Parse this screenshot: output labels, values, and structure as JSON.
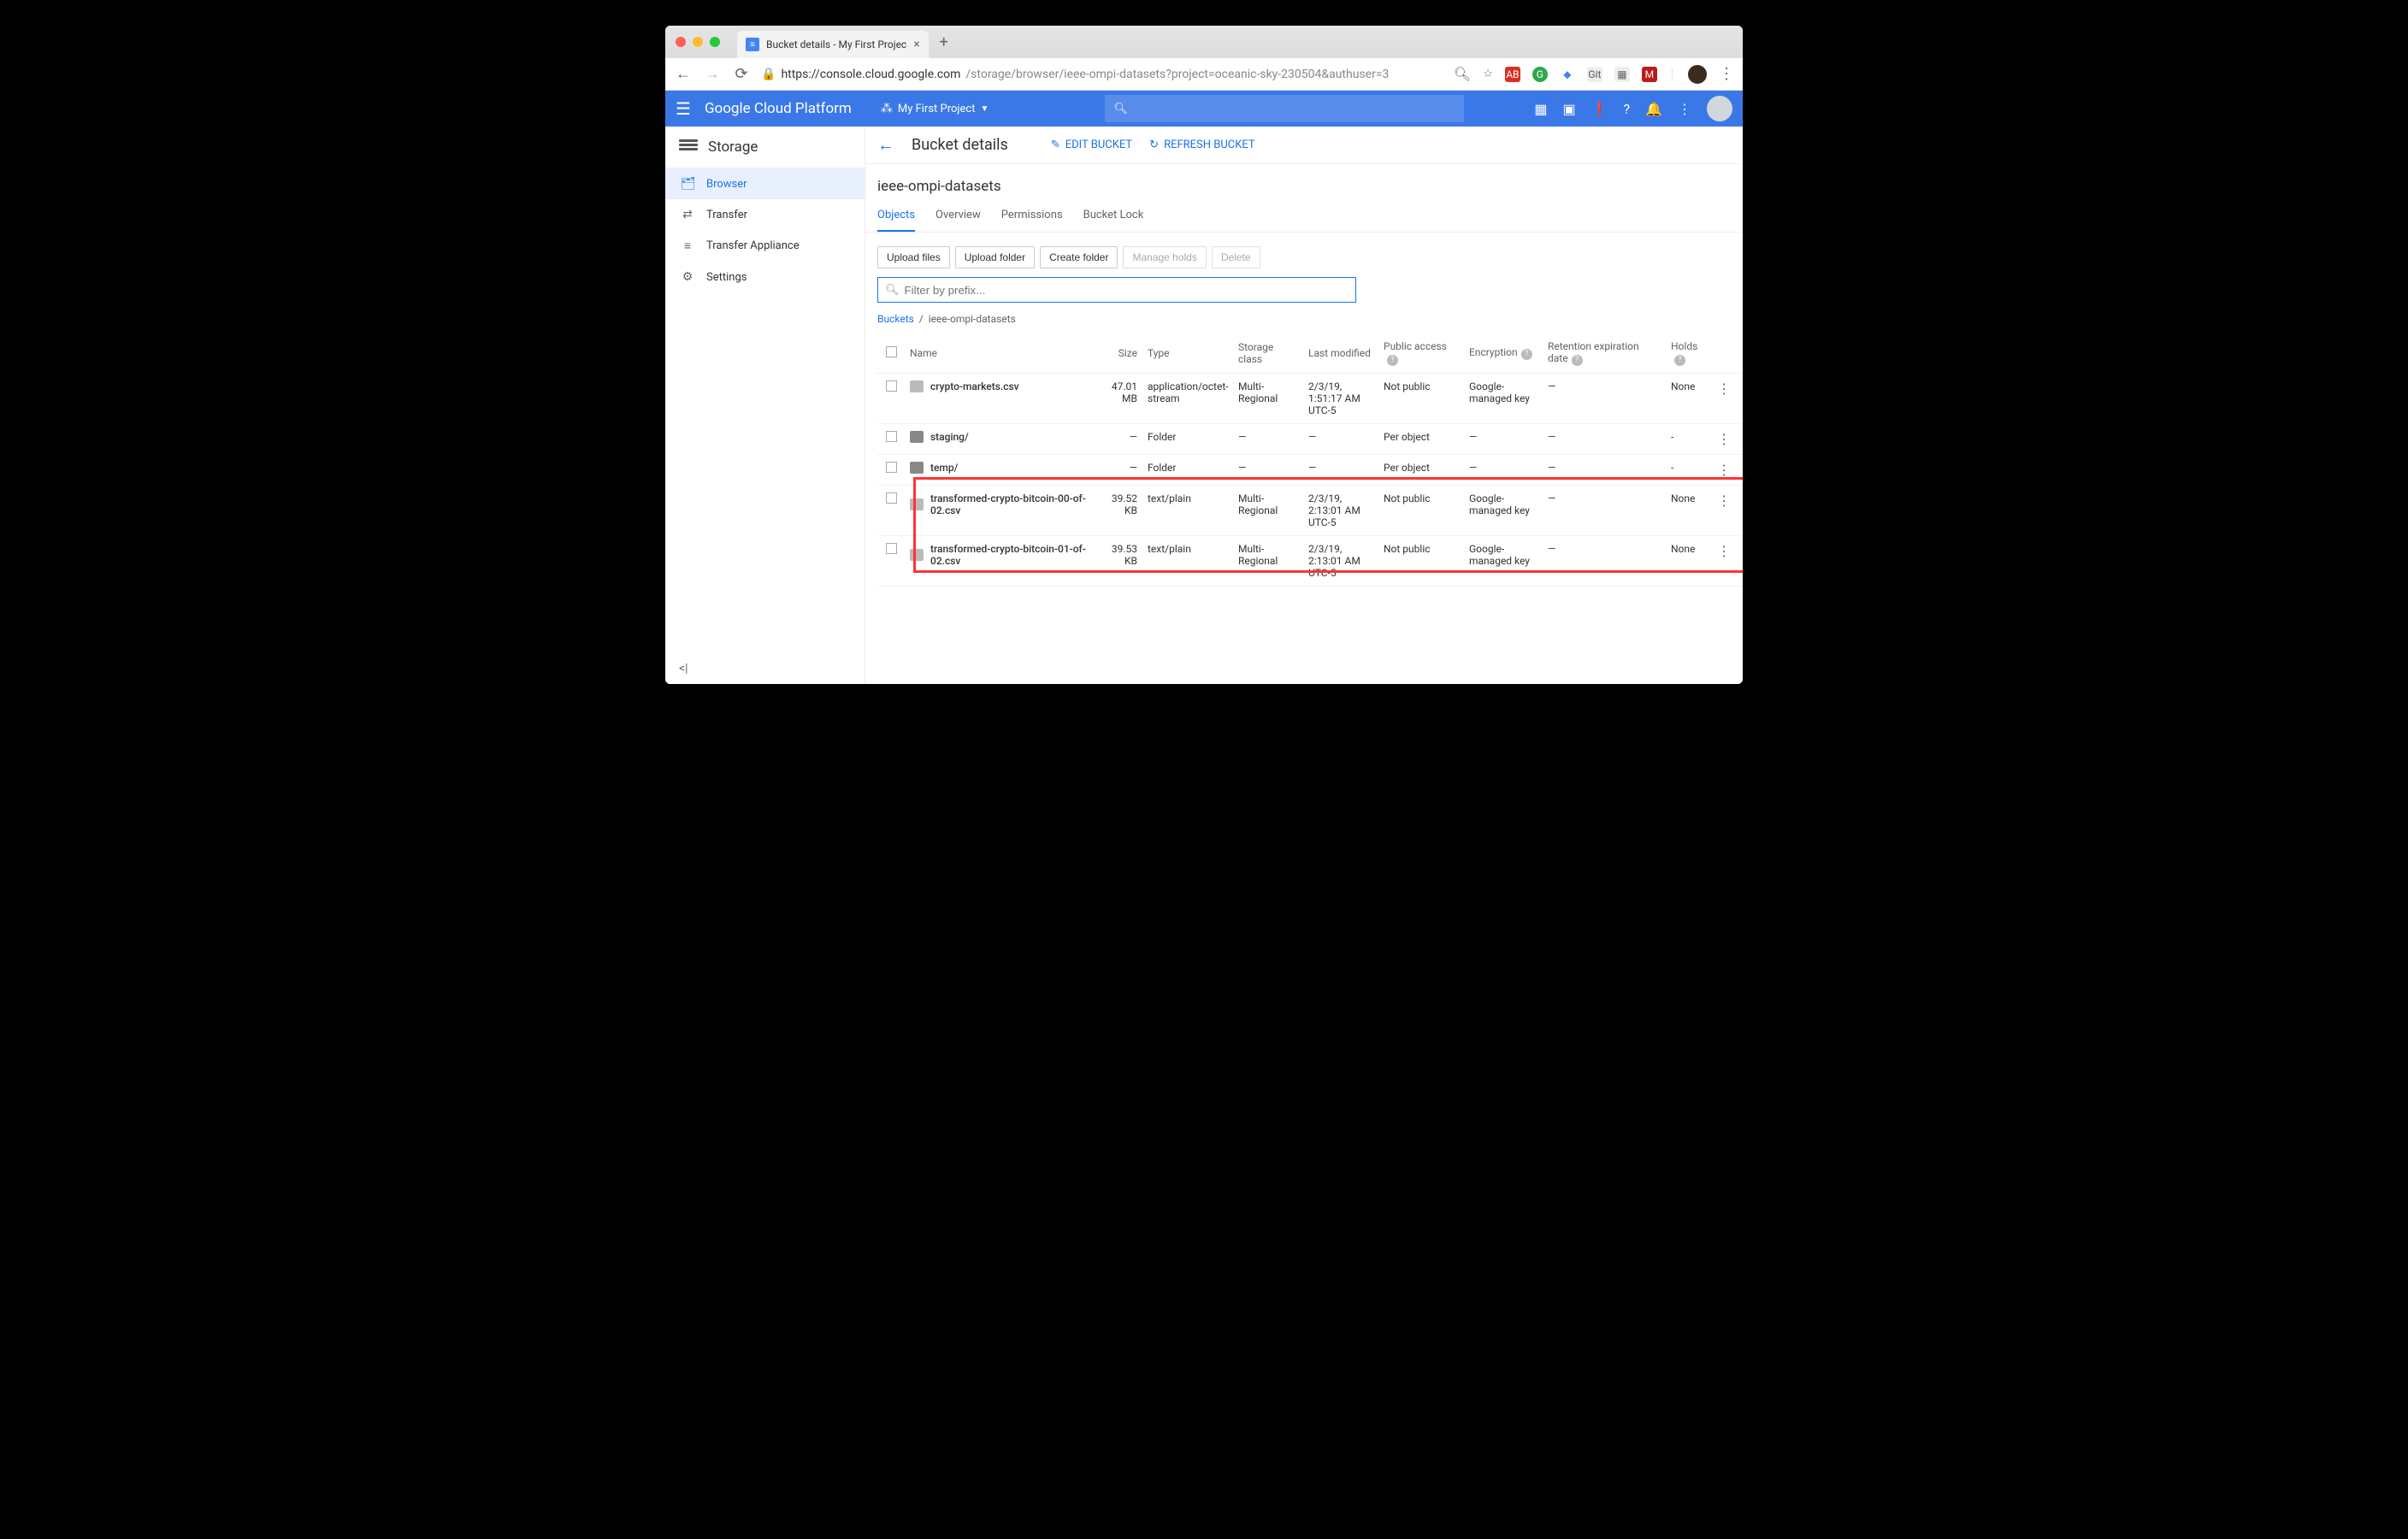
{
  "browser": {
    "tab_title": "Bucket details - My First Projec",
    "url_host": "https://console.cloud.google.com",
    "url_path": "/storage/browser/ieee-ompi-datasets?project=oceanic-sky-230504&authuser=3"
  },
  "gcp_header": {
    "product": "Google Cloud Platform",
    "project": "My First Project"
  },
  "sidebar": {
    "title": "Storage",
    "items": [
      {
        "label": "Browser",
        "icon": "🗂",
        "active": true
      },
      {
        "label": "Transfer",
        "icon": "⇄",
        "active": false
      },
      {
        "label": "Transfer Appliance",
        "icon": "≡",
        "active": false
      },
      {
        "label": "Settings",
        "icon": "⚙",
        "active": false
      }
    ]
  },
  "titlebar": {
    "title": "Bucket details",
    "actions": {
      "edit": "EDIT BUCKET",
      "refresh": "REFRESH BUCKET"
    }
  },
  "bucket_name": "ieee-ompi-datasets",
  "tabs": [
    {
      "label": "Objects",
      "active": true
    },
    {
      "label": "Overview",
      "active": false
    },
    {
      "label": "Permissions",
      "active": false
    },
    {
      "label": "Bucket Lock",
      "active": false
    }
  ],
  "ops": {
    "upload_files": "Upload files",
    "upload_folder": "Upload folder",
    "create_folder": "Create folder",
    "manage_holds": "Manage holds",
    "delete": "Delete"
  },
  "filter_placeholder": "Filter by prefix...",
  "breadcrumb": {
    "root": "Buckets",
    "current": "ieee-ompi-datasets"
  },
  "columns": {
    "name": "Name",
    "size": "Size",
    "type": "Type",
    "storage_class": "Storage class",
    "last_modified": "Last modified",
    "public_access": "Public access",
    "encryption": "Encryption",
    "retention": "Retention expiration date",
    "holds": "Holds"
  },
  "rows": [
    {
      "kind": "file",
      "name": "crypto-markets.csv",
      "size": "47.01 MB",
      "type": "application/octet-stream",
      "storage_class": "Multi-Regional",
      "last_modified": "2/3/19, 1:51:17 AM UTC-5",
      "public_access": "Not public",
      "encryption": "Google-managed key",
      "retention": "—",
      "holds": "None"
    },
    {
      "kind": "folder",
      "name": "staging/",
      "size": "—",
      "type": "Folder",
      "storage_class": "—",
      "last_modified": "—",
      "public_access": "Per object",
      "encryption": "—",
      "retention": "—",
      "holds": "-"
    },
    {
      "kind": "folder",
      "name": "temp/",
      "size": "—",
      "type": "Folder",
      "storage_class": "—",
      "last_modified": "—",
      "public_access": "Per object",
      "encryption": "—",
      "retention": "—",
      "holds": "-"
    },
    {
      "kind": "file",
      "name": "transformed-crypto-bitcoin-00-of-02.csv",
      "size": "39.52 KB",
      "type": "text/plain",
      "storage_class": "Multi-Regional",
      "last_modified": "2/3/19, 2:13:01 AM UTC-5",
      "public_access": "Not public",
      "encryption": "Google-managed key",
      "retention": "—",
      "holds": "None"
    },
    {
      "kind": "file",
      "name": "transformed-crypto-bitcoin-01-of-02.csv",
      "size": "39.53 KB",
      "type": "text/plain",
      "storage_class": "Multi-Regional",
      "last_modified": "2/3/19, 2:13:01 AM UTC-5",
      "public_access": "Not public",
      "encryption": "Google-managed key",
      "retention": "—",
      "holds": "None"
    }
  ]
}
